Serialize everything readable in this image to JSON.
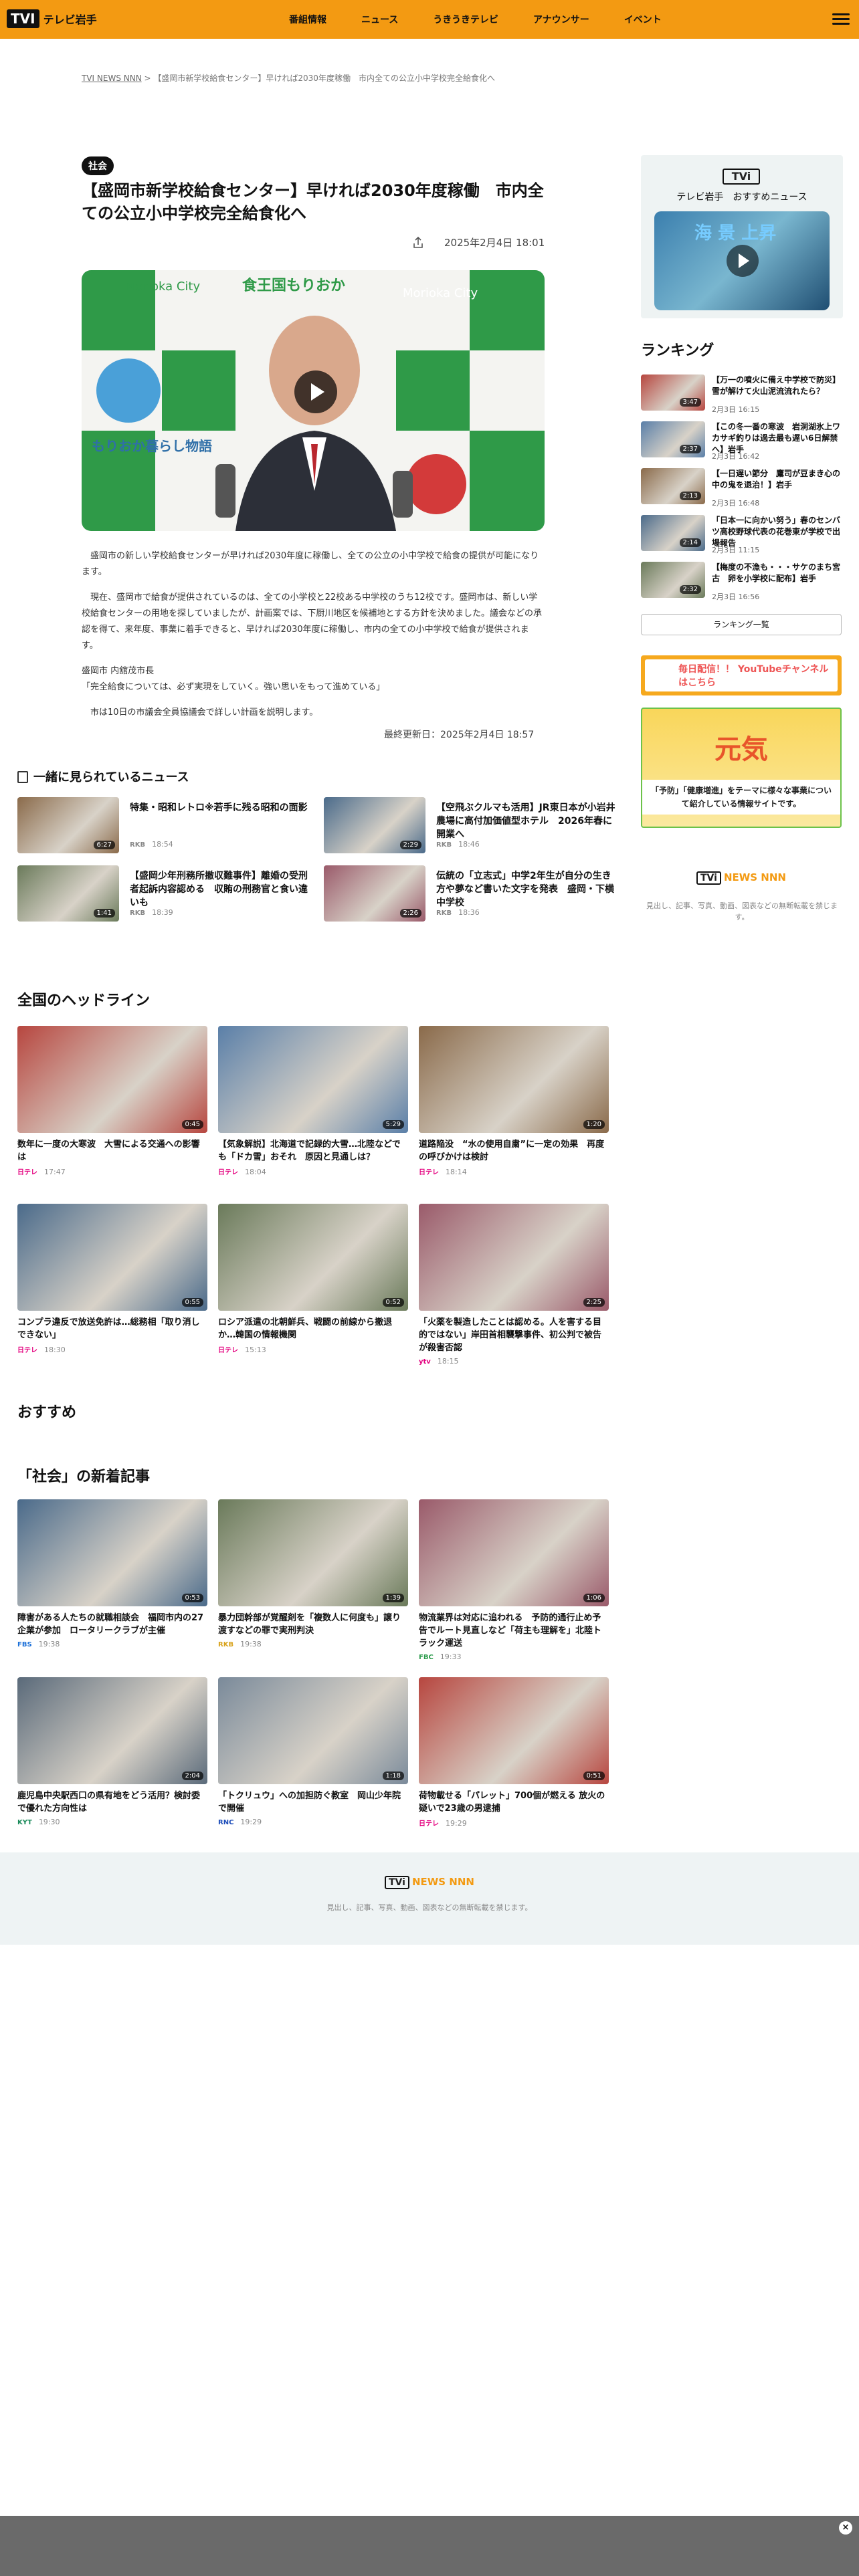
{
  "header": {
    "logo": "TVI",
    "site": "テレビ岩手",
    "nav": [
      "番組情報",
      "ニュース",
      "うきうきテレビ",
      "アナウンサー",
      "イベント"
    ]
  },
  "breadcrumb": {
    "home": "TVI NEWS NNN",
    "sep": ">",
    "current": "【盛岡市新学校給食センター】早ければ2030年度稼働　市内全ての公立小中学校完全給食化へ"
  },
  "article": {
    "tag": "社会",
    "title": "【盛岡市新学校給食センター】早ければ2030年度稼働　市内全ての公立小中学校完全給食化へ",
    "date": "2025年2月4日 18:01",
    "paragraphs": [
      "　盛岡市の新しい学校給食センターが早ければ2030年度に稼働し、全ての公立の小中学校で給食の提供が可能になります。",
      "　現在、盛岡市で給食が提供されているのは、全ての小学校と22校ある中学校のうち12校です。盛岡市は、新しい学校給食センターの用地を探していましたが、計画案では、下厨川地区を候補地とする方針を決めました。議会などの承認を得て、来年度、事業に着手できると、早ければ2030年度に稼働し、市内の全ての小中学校で給食が提供されます。",
      "盛岡市 内舘茂市長\n「完全給食については、必ず実現をしていく。強い思いをもって進めている」",
      "　市は10日の市議会全員協議会で詳しい計画を説明します。"
    ],
    "updated": "最終更新日：2025年2月4日 18:57",
    "hero_signs": [
      "Morioka City",
      "もりおか暮らし物語",
      "食王国もりおか"
    ]
  },
  "recommend": {
    "logo": "TVi",
    "title": "テレビ岩手　おすすめニュース",
    "video_text": "海 景 上昇"
  },
  "ranking": {
    "heading": "ランキング",
    "items": [
      {
        "title": "【万一の噴火に備え中学校で防災】雪が解けて火山泥流流れたら？",
        "time": "2月3日 16:15",
        "dur": "3:47"
      },
      {
        "title": "【この冬一番の寒波　岩洞湖氷上ワカサギ釣りは過去最も遅い6日解禁へ】岩手",
        "time": "2月3日 16:42",
        "dur": "2:37"
      },
      {
        "title": "【一日遅い節分　鷹司が豆まき心の中の鬼を退治！】岩手",
        "time": "2月3日 16:48",
        "dur": "2:13"
      },
      {
        "title": "「日本一に向かい努う」春のセンバツ高校野球代表の花巻東が学校で出場報告",
        "time": "2月3日 11:15",
        "dur": "2:14"
      },
      {
        "title": "【梅度の不漁も・・・サケのまち宮古　卵を小学校に配布】岩手",
        "time": "2月3日 16:56",
        "dur": "2:32"
      }
    ],
    "more": "ランキング一覧"
  },
  "banners": {
    "youtube": "毎日配信！！ YouTubeチャンネルはこちら",
    "genki_title": "元気",
    "genki_text": "「予防」「健康増進」をテーマに様々な事業について紹介している情報サイトです。"
  },
  "nnn": {
    "logo": "TVi",
    "brand": "NEWS NNN",
    "note": "見出し、記事、写真、動画、図表などの無断転載を禁じます。"
  },
  "related": {
    "heading": "一緒に見られているニュース",
    "items": [
      {
        "title": "特集・昭和レトロ※若手に残る昭和の面影",
        "src": "RKB",
        "time": "18:54",
        "dur": "6:27"
      },
      {
        "title": "【空飛ぶクルマも活用】JR東日本が小岩井農場に高付加価値型ホテル　2026年春に開業へ",
        "src": "RKB",
        "time": "18:46",
        "dur": "2:29"
      },
      {
        "title": "【盛岡少年刑務所撤収難事件】離婚の受刑者起訴内容認める　収賄の刑務官と食い違いも",
        "src": "RKB",
        "time": "18:39",
        "dur": "1:41"
      },
      {
        "title": "伝統の「立志式」中学2年生が自分の生き方や夢など書いた文字を発表　盛岡・下横中学校",
        "src": "RKB",
        "time": "18:36",
        "dur": "2:26"
      }
    ]
  },
  "national": {
    "heading": "全国のヘッドライン",
    "items": [
      {
        "title": "数年に一度の大寒波　大雪による交通への影響は",
        "src": "日テレ",
        "time": "17:47",
        "dur": "0:45"
      },
      {
        "title": "【気象解説】北海道で記録的大雪…北陸などでも「ドカ雪」おそれ　原因と見通しは？",
        "src": "日テレ",
        "time": "18:04",
        "dur": "5:29"
      },
      {
        "title": "道路陥没　“水の使用自粛”に一定の効果　再度の呼びかけは検討",
        "src": "日テレ",
        "time": "18:14",
        "dur": "1:20"
      },
      {
        "title": "コンプラ違反で放送免許は…総務相「取り消しできない」",
        "src": "日テレ",
        "time": "18:30",
        "dur": "0:55"
      },
      {
        "title": "ロシア派遣の北朝鮮兵、戦闘の前線から撤退か…韓国の情報機関",
        "src": "日テレ",
        "time": "15:13",
        "dur": "0:52"
      },
      {
        "title": "「火薬を製造したことは認める。人を害する目的ではない」岸田首相襲撃事件、初公判で被告が殺害否認",
        "src": "ytv",
        "time": "18:15",
        "dur": "2:25"
      }
    ]
  },
  "osusume": {
    "heading": "おすすめ"
  },
  "latest": {
    "heading": "「社会」の新着記事",
    "items": [
      {
        "title": "障害がある人たちの就職相談会　福岡市内の27企業が参加　ロータリークラブが主催",
        "src": "FBS",
        "time": "19:38",
        "dur": "0:53"
      },
      {
        "title": "暴力団幹部が覚醒剤を「複数人に何度も」譲り渡すなどの罪で実刑判決",
        "src": "RKB",
        "time": "19:38",
        "dur": "1:39"
      },
      {
        "title": "物流業界は対応に追われる　予防的通行止め予告でルート見直しなど「荷主も理解を」北陸トラック運送",
        "src": "FBC",
        "time": "19:33",
        "dur": "1:06"
      },
      {
        "title": "鹿児島中央駅西口の県有地をどう活用？検討委で優れた方向性は",
        "src": "KYT",
        "time": "19:30",
        "dur": "2:04"
      },
      {
        "title": "「トクリュウ」への加担防ぐ教室　岡山少年院で開催",
        "src": "RNC",
        "time": "19:29",
        "dur": "1:18"
      },
      {
        "title": "荷物載せる「パレット」700個が燃える 放火の疑いで23歳の男逮捕",
        "src": "日テレ",
        "time": "19:29",
        "dur": "0:51"
      }
    ]
  },
  "colors": {
    "brand": "#f39a12",
    "text": "#222222"
  }
}
